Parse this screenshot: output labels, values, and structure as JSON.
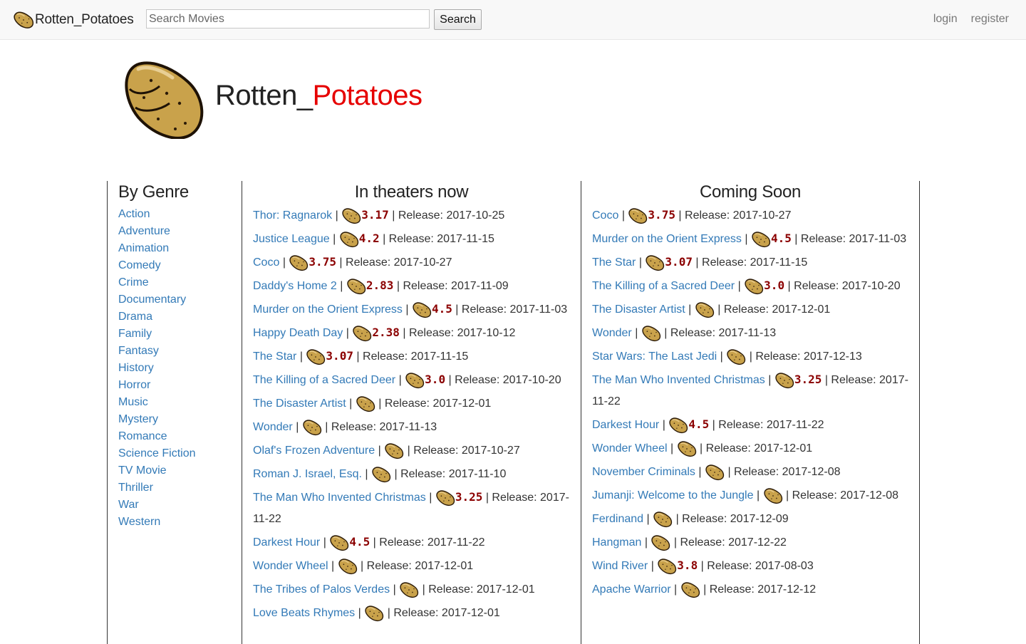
{
  "navbar": {
    "brand": "Rotten_Potatoes",
    "search_placeholder": "Search Movies",
    "search_button": "Search",
    "login": "login",
    "register": "register"
  },
  "hero": {
    "title_part1": "Rotten_",
    "title_part2": "Potatoes"
  },
  "genres": {
    "heading": "By Genre",
    "items": [
      "Action",
      "Adventure",
      "Animation",
      "Comedy",
      "Crime",
      "Documentary",
      "Drama",
      "Family",
      "Fantasy",
      "History",
      "Horror",
      "Music",
      "Mystery",
      "Romance",
      "Science Fiction",
      "TV Movie",
      "Thriller",
      "War",
      "Western"
    ]
  },
  "release_label": "Release:",
  "separator": "|",
  "theaters": {
    "heading": "In theaters now",
    "movies": [
      {
        "title": "Thor: Ragnarok",
        "score": "3.17",
        "release": "2017-10-25"
      },
      {
        "title": "Justice League",
        "score": "4.2",
        "release": "2017-11-15"
      },
      {
        "title": "Coco",
        "score": "3.75",
        "release": "2017-10-27"
      },
      {
        "title": "Daddy's Home 2",
        "score": "2.83",
        "release": "2017-11-09"
      },
      {
        "title": "Murder on the Orient Express",
        "score": "4.5",
        "release": "2017-11-03"
      },
      {
        "title": "Happy Death Day",
        "score": "2.38",
        "release": "2017-10-12"
      },
      {
        "title": "The Star",
        "score": "3.07",
        "release": "2017-11-15"
      },
      {
        "title": "The Killing of a Sacred Deer",
        "score": "3.0",
        "release": "2017-10-20"
      },
      {
        "title": "The Disaster Artist",
        "score": "",
        "release": "2017-12-01"
      },
      {
        "title": "Wonder",
        "score": "",
        "release": "2017-11-13"
      },
      {
        "title": "Olaf's Frozen Adventure",
        "score": "",
        "release": "2017-10-27"
      },
      {
        "title": "Roman J. Israel, Esq.",
        "score": "",
        "release": "2017-11-10"
      },
      {
        "title": "The Man Who Invented Christmas",
        "score": "3.25",
        "release": "2017-11-22"
      },
      {
        "title": "Darkest Hour",
        "score": "4.5",
        "release": "2017-11-22"
      },
      {
        "title": "Wonder Wheel",
        "score": "",
        "release": "2017-12-01"
      },
      {
        "title": "The Tribes of Palos Verdes",
        "score": "",
        "release": "2017-12-01"
      },
      {
        "title": "Love Beats Rhymes",
        "score": "",
        "release": "2017-12-01"
      }
    ]
  },
  "coming_soon": {
    "heading": "Coming Soon",
    "movies": [
      {
        "title": "Coco",
        "score": "3.75",
        "release": "2017-10-27"
      },
      {
        "title": "Murder on the Orient Express",
        "score": "4.5",
        "release": "2017-11-03"
      },
      {
        "title": "The Star",
        "score": "3.07",
        "release": "2017-11-15"
      },
      {
        "title": "The Killing of a Sacred Deer",
        "score": "3.0",
        "release": "2017-10-20"
      },
      {
        "title": "The Disaster Artist",
        "score": "",
        "release": "2017-12-01"
      },
      {
        "title": "Wonder",
        "score": "",
        "release": "2017-11-13"
      },
      {
        "title": "Star Wars: The Last Jedi",
        "score": "",
        "release": "2017-12-13"
      },
      {
        "title": "The Man Who Invented Christmas",
        "score": "3.25",
        "release": "2017-11-22"
      },
      {
        "title": "Darkest Hour",
        "score": "4.5",
        "release": "2017-11-22"
      },
      {
        "title": "Wonder Wheel",
        "score": "",
        "release": "2017-12-01"
      },
      {
        "title": "November Criminals",
        "score": "",
        "release": "2017-12-08"
      },
      {
        "title": "Jumanji: Welcome to the Jungle",
        "score": "",
        "release": "2017-12-08"
      },
      {
        "title": "Ferdinand",
        "score": "",
        "release": "2017-12-09"
      },
      {
        "title": "Hangman",
        "score": "",
        "release": "2017-12-22"
      },
      {
        "title": "Wind River",
        "score": "3.8",
        "release": "2017-08-03"
      },
      {
        "title": "Apache Warrior",
        "score": "",
        "release": "2017-12-12"
      }
    ]
  }
}
